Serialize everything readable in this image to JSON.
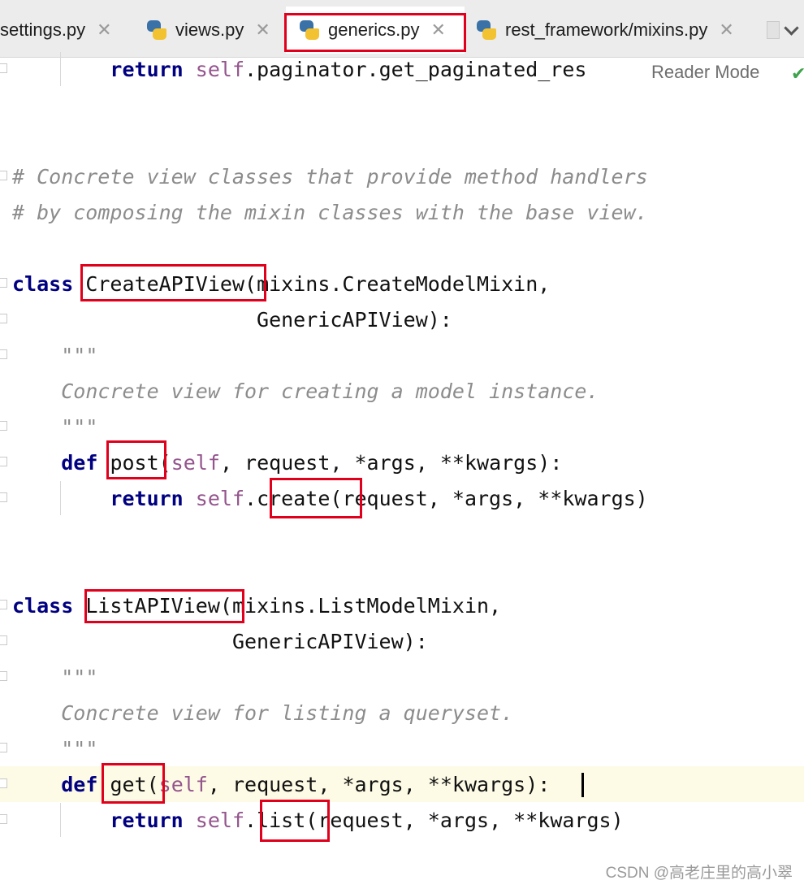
{
  "tabs": [
    {
      "label": "settings.py",
      "close": "✕"
    },
    {
      "label": "views.py",
      "close": "✕"
    },
    {
      "label": "generics.py",
      "close": "✕"
    },
    {
      "label": "rest_framework/mixins.py",
      "close": "✕"
    }
  ],
  "toolbar": {
    "reader_mode": "Reader Mode",
    "check_icon": "✔"
  },
  "code": {
    "l1": {
      "kw": "return",
      "self": "self",
      "rest": ".paginator.get_paginated_res"
    },
    "c1": "# Concrete view classes that provide method handlers",
    "c2": "# by composing the mixin classes with the base view.",
    "class1": {
      "kw": "class",
      "name": "CreateAPIView",
      "open": "(",
      "base1": "mixins.CreateModelMixin,",
      "base2": "GenericAPIView):"
    },
    "doc1": {
      "q1": "\"\"\"",
      "text": "Concrete view for creating a model instance.",
      "q2": "\"\"\""
    },
    "def1": {
      "kw": "def",
      "name": "post",
      "open": "(",
      "self": "self",
      "args": ", request, *args, **kwargs):"
    },
    "ret1": {
      "kw": "return",
      "self": "self",
      "dot": ".",
      "method": "create",
      "args": "(request, *args, **kwargs)"
    },
    "class2": {
      "kw": "class",
      "name": "ListAPIView",
      "open": "(",
      "base1": "mixins.ListModelMixin,",
      "base2": "GenericAPIView):"
    },
    "doc2": {
      "q1": "\"\"\"",
      "text": "Concrete view for listing a queryset.",
      "q2": "\"\"\""
    },
    "def2": {
      "kw": "def",
      "name": "get",
      "open": "(",
      "self": "self",
      "args": ", request, *args, **kwargs):"
    },
    "ret2": {
      "kw": "return",
      "self": "self",
      "dot": ".",
      "method": "list",
      "args": "(request, *args, **kwargs)"
    }
  },
  "watermark": "CSDN @高老庄里的高小翠",
  "colors": {
    "keyword": "#000080",
    "self": "#94558d",
    "comment": "#8c8c8c",
    "highlight": "#e0001b",
    "caret_line": "#fdfbe5"
  }
}
